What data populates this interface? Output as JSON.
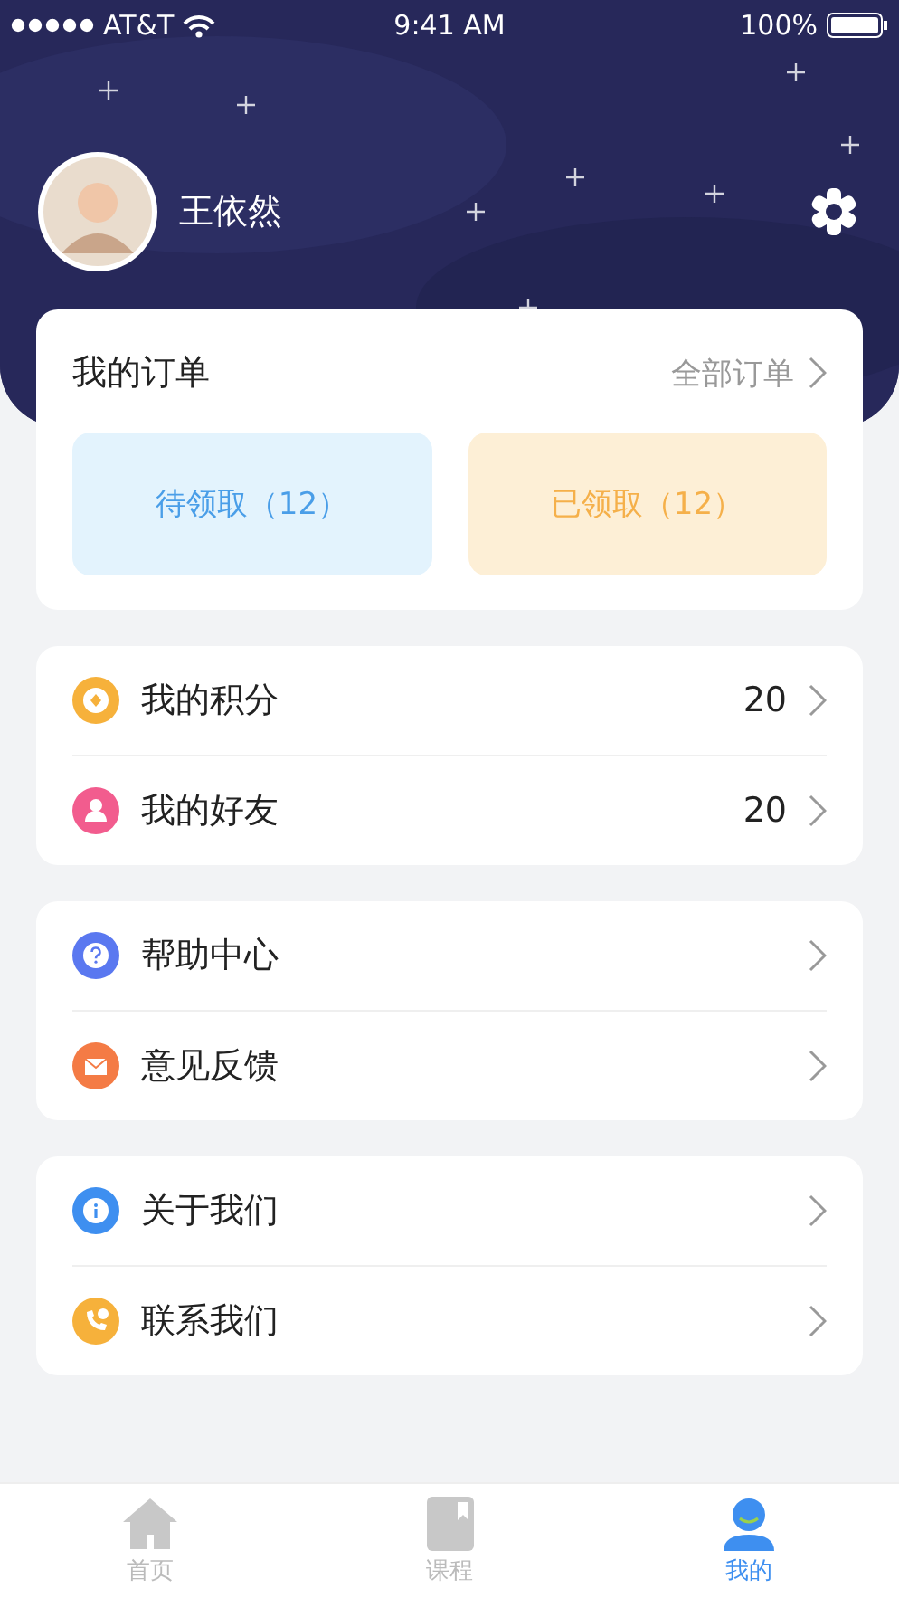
{
  "status_bar": {
    "carrier": "AT&T",
    "time": "9:41 AM",
    "battery": "100%"
  },
  "profile": {
    "name": "王依然"
  },
  "orders": {
    "title": "我的订单",
    "all_link": "全部订单",
    "tiles": [
      {
        "label": "待领取（12）",
        "kind": "pending"
      },
      {
        "label": "已领取（12）",
        "kind": "received"
      }
    ]
  },
  "groups": [
    {
      "items": [
        {
          "label": "我的积分",
          "value": "20",
          "kind": "points",
          "color": "#f6b13b"
        },
        {
          "label": "我的好友",
          "value": "20",
          "kind": "friends",
          "color": "#f25c8e"
        }
      ]
    },
    {
      "items": [
        {
          "label": "帮助中心",
          "kind": "help",
          "color": "#5a78f0"
        },
        {
          "label": "意见反馈",
          "kind": "feedback",
          "color": "#f47b45"
        }
      ]
    },
    {
      "items": [
        {
          "label": "关于我们",
          "kind": "about",
          "color": "#3e8ff0"
        },
        {
          "label": "联系我们",
          "kind": "contact",
          "color": "#f6b13b"
        }
      ]
    }
  ],
  "tab_bar": [
    {
      "label": "首页",
      "kind": "home",
      "selected": false
    },
    {
      "label": "课程",
      "kind": "course",
      "selected": false
    },
    {
      "label": "我的",
      "kind": "me",
      "selected": true
    }
  ]
}
